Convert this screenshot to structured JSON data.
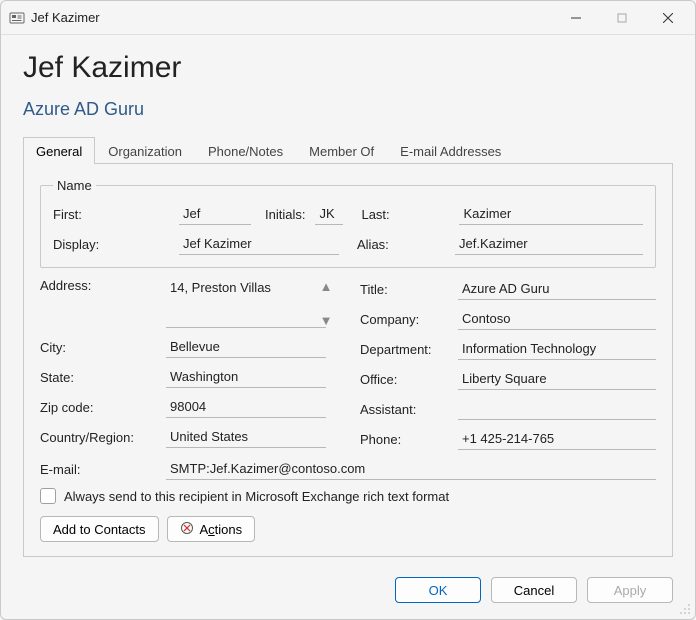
{
  "window": {
    "title": "Jef Kazimer"
  },
  "header": {
    "name": "Jef Kazimer",
    "subtitle": "Azure AD Guru"
  },
  "tabs": {
    "general": "General",
    "organization": "Organization",
    "phone_notes": "Phone/Notes",
    "member_of": "Member Of",
    "email_addresses": "E-mail Addresses",
    "active": "general"
  },
  "name_group": {
    "legend": "Name",
    "first_label": "First:",
    "first": "Jef",
    "initials_label": "Initials:",
    "initials": "JK",
    "last_label": "Last:",
    "last": "Kazimer",
    "display_label": "Display:",
    "display": "Jef Kazimer",
    "alias_label": "Alias:",
    "alias": "Jef.Kazimer"
  },
  "left": {
    "address_label": "Address:",
    "address": "14, Preston Villas",
    "city_label": "City:",
    "city": "Bellevue",
    "state_label": "State:",
    "state": "Washington",
    "zip_label": "Zip code:",
    "zip": "98004",
    "country_label": "Country/Region:",
    "country": "United States"
  },
  "right": {
    "title_label": "Title:",
    "title": "Azure AD Guru",
    "company_label": "Company:",
    "company": "Contoso",
    "department_label": "Department:",
    "department": "Information Technology",
    "office_label": "Office:",
    "office": "Liberty Square",
    "assistant_label": "Assistant:",
    "assistant": "",
    "phone_label": "Phone:",
    "phone": "+1 425-214-765"
  },
  "email": {
    "label": "E-mail:",
    "value": "SMTP:Jef.Kazimer@contoso.com"
  },
  "richtext": {
    "label": "Always send to this recipient in Microsoft Exchange rich text format",
    "checked": false
  },
  "buttons": {
    "add_to_contacts": "Add to Contacts",
    "actions_prefix": "A",
    "actions_underline": "c",
    "actions_suffix": "tions"
  },
  "dialog_buttons": {
    "ok": "OK",
    "cancel": "Cancel",
    "apply": "Apply"
  }
}
